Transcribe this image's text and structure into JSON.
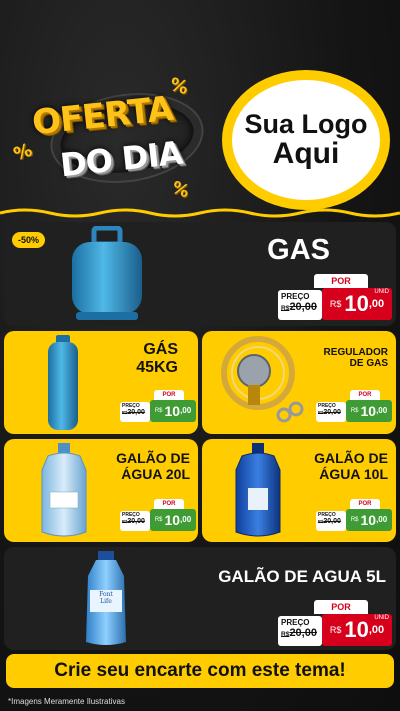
{
  "header": {
    "headline_top": "OFERTA",
    "headline_bottom": "DO DIA",
    "percent_symbol": "%",
    "logo_line1": "Sua Logo",
    "logo_line2": "Aqui"
  },
  "colors": {
    "accent": "#ffcc00",
    "price_red": "#d6001c",
    "price_green": "#3f9c35",
    "dark_card": "#202020"
  },
  "price_labels": {
    "preco": "PREÇO",
    "por": "POR",
    "currency": "R$",
    "unit": "UNID"
  },
  "products": [
    {
      "name": "GAS",
      "discount_badge": "-50%",
      "old_price": "20,00",
      "old_prefix": "R$",
      "new_int": "10",
      "new_dec": ",00",
      "image": "blue-gas-cylinder"
    },
    {
      "name_line1": "GÁS",
      "name_line2": "45KG",
      "old_price": "20,00",
      "old_prefix": "R$",
      "new_int": "10",
      "new_dec": ",00",
      "image": "tall-blue-gas-cylinder"
    },
    {
      "name_line1": "REGULADOR",
      "name_line2": "DE GAS",
      "old_price": "20,00",
      "old_prefix": "R$",
      "new_int": "10",
      "new_dec": ",00",
      "image": "gas-regulator-hose"
    },
    {
      "name_line1": "GALÃO DE",
      "name_line2": "ÁGUA 20L",
      "old_price": "20,00",
      "old_prefix": "R$",
      "new_int": "10",
      "new_dec": ",00",
      "image": "water-jug-20l"
    },
    {
      "name_line1": "GALÃO DE",
      "name_line2": "ÁGUA 10L",
      "old_price": "20,00",
      "old_prefix": "R$",
      "new_int": "10",
      "new_dec": ",00",
      "image": "water-jug-10l"
    },
    {
      "name": "GALÃO DE AGUA 5L",
      "old_price": "20,00",
      "old_prefix": "R$",
      "new_int": "10",
      "new_dec": ",00",
      "image": "water-bottle-5l",
      "bottle_brand_line1": "Font",
      "bottle_brand_line2": "Life"
    }
  ],
  "footer": {
    "cta": "Crie seu encarte com este tema!",
    "note": "*Imagens Meramente Ilustrativas"
  }
}
